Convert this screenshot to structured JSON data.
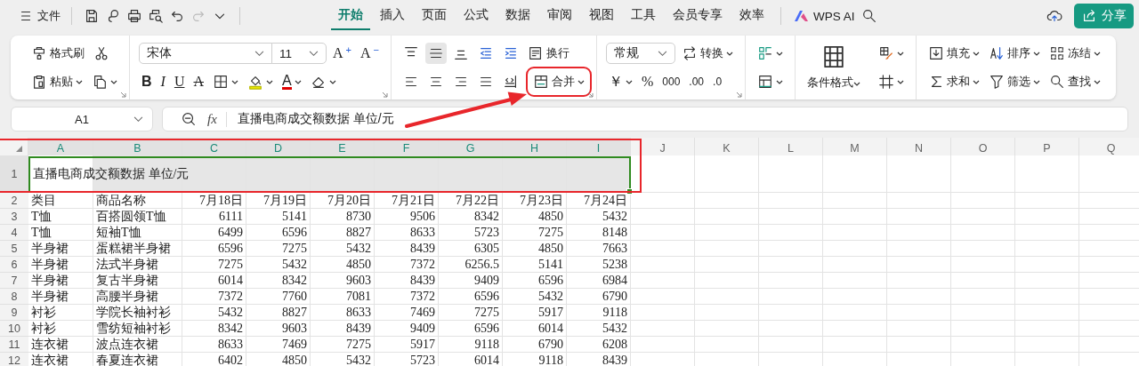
{
  "menu": {
    "label": "文件"
  },
  "quick_access": [
    {
      "kind": "save",
      "disabled": false
    },
    {
      "kind": "curve",
      "disabled": false
    },
    {
      "kind": "print",
      "disabled": false
    },
    {
      "kind": "preview",
      "disabled": false
    },
    {
      "kind": "undo",
      "disabled": false
    },
    {
      "kind": "redo",
      "disabled": true
    },
    {
      "kind": "more",
      "disabled": false
    }
  ],
  "tabs": [
    {
      "label": "开始",
      "selected": true
    },
    {
      "label": "插入",
      "selected": false
    },
    {
      "label": "页面",
      "selected": false
    },
    {
      "label": "公式",
      "selected": false
    },
    {
      "label": "数据",
      "selected": false
    },
    {
      "label": "审阅",
      "selected": false
    },
    {
      "label": "视图",
      "selected": false
    },
    {
      "label": "工具",
      "selected": false
    },
    {
      "label": "会员专享",
      "selected": false
    },
    {
      "label": "效率",
      "selected": false
    }
  ],
  "ai_button": {
    "label": "WPS AI"
  },
  "share_button": {
    "label": "分享"
  },
  "ribbon": [
    {
      "kind": "two-line",
      "launcher": true,
      "top": [
        {
          "kind": "format-painter",
          "label": "格式刷",
          "dropdown": false
        },
        {
          "kind": "scissors",
          "dropdown": false
        }
      ],
      "bottom": [
        {
          "kind": "paste",
          "label": "粘贴",
          "dropdown": true
        },
        {
          "kind": "copy",
          "dropdown": true
        }
      ]
    },
    {
      "kind": "two-line",
      "launcher": true,
      "top": [
        {
          "kind": "font-select",
          "value": "宋体",
          "dropdown": true
        },
        {
          "kind": "size-select",
          "value": "11",
          "dropdown": true
        },
        {
          "kind": "grow",
          "glyph": "A",
          "sup": "+",
          "dropdown": false
        },
        {
          "kind": "shrink",
          "glyph": "A",
          "sup": "−",
          "dropdown": false
        }
      ],
      "bottom": [
        {
          "kind": "bold",
          "glyph": "B",
          "dropdown": false
        },
        {
          "kind": "italic",
          "glyph": "I",
          "dropdown": false
        },
        {
          "kind": "underline",
          "glyph": "U",
          "dropdown": false
        },
        {
          "kind": "strike",
          "glyph": "A",
          "dropdown": false
        },
        {
          "kind": "borders",
          "dropdown": true
        },
        {
          "kind": "fill-color",
          "dropdown": true
        },
        {
          "kind": "font-color",
          "glyph": "A",
          "dropdown": true
        },
        {
          "kind": "eraser",
          "dropdown": true
        }
      ]
    },
    {
      "kind": "two-line",
      "launcher": true,
      "top": [
        {
          "kind": "align-top",
          "selected": false,
          "dropdown": false
        },
        {
          "kind": "align-middle",
          "selected": true,
          "dropdown": false
        },
        {
          "kind": "align-bottom",
          "selected": false,
          "dropdown": false
        },
        {
          "kind": "outdent",
          "selected": false,
          "dropdown": false
        },
        {
          "kind": "indent",
          "selected": false,
          "dropdown": false
        },
        {
          "kind": "wrap",
          "label": "换行",
          "selected": false,
          "dropdown": false
        }
      ],
      "bottom": [
        {
          "kind": "align-left",
          "selected": false,
          "dropdown": false
        },
        {
          "kind": "align-center",
          "selected": false,
          "dropdown": false
        },
        {
          "kind": "align-right",
          "selected": false,
          "dropdown": false
        },
        {
          "kind": "justify",
          "selected": false,
          "dropdown": false
        },
        {
          "kind": "distribute",
          "selected": false,
          "dropdown": false
        },
        {
          "kind": "merge",
          "label": "合并",
          "selected": false,
          "dropdown": true
        }
      ]
    },
    {
      "kind": "two-line",
      "launcher": true,
      "top": [
        {
          "kind": "format-select",
          "value": "常规",
          "dropdown": true
        },
        {
          "kind": "convert",
          "label": "转换",
          "dropdown": true
        }
      ],
      "bottom": [
        {
          "kind": "currency",
          "glyph": "￥",
          "dropdown": true
        },
        {
          "kind": "percent",
          "glyph": "%",
          "dropdown": false
        },
        {
          "kind": "thousands",
          "glyph": "000",
          "dropdown": false
        },
        {
          "kind": "decimal-more",
          "glyph": ".00",
          "dropdown": false
        },
        {
          "kind": "decimal-less",
          "glyph": ".0",
          "dropdown": false
        }
      ]
    },
    {
      "kind": "two-line",
      "launcher": false,
      "top": [
        {
          "kind": "cell-style",
          "dropdown": true
        }
      ],
      "bottom": [
        {
          "kind": "table-style",
          "dropdown": true
        }
      ]
    },
    {
      "kind": "big",
      "launcher": false,
      "big": {
        "kind": "conditional",
        "label": "条件格式",
        "dropdown": true
      },
      "top": [
        {
          "kind": "cell-paint",
          "dropdown": true
        }
      ],
      "bottom": [
        {
          "kind": "row-column",
          "dropdown": true
        }
      ]
    },
    {
      "kind": "two-line",
      "launcher": false,
      "top": [
        {
          "kind": "fill",
          "label": "填充",
          "dropdown": true
        },
        {
          "kind": "sort",
          "label": "排序",
          "dropdown": true
        },
        {
          "kind": "freeze",
          "label": "冻结",
          "dropdown": true
        }
      ],
      "bottom": [
        {
          "kind": "sum",
          "label": "求和",
          "dropdown": true
        },
        {
          "kind": "filter",
          "label": "筛选",
          "dropdown": true
        },
        {
          "kind": "find",
          "label": "查找",
          "dropdown": true
        }
      ]
    }
  ],
  "name_box": {
    "value": "A1"
  },
  "formula_bar": {
    "fx": "fx",
    "value": "直播电商成交额数据  单位/元"
  },
  "columns": [
    {
      "letter": "A",
      "selected": true
    },
    {
      "letter": "B",
      "selected": true
    },
    {
      "letter": "C",
      "selected": true
    },
    {
      "letter": "D",
      "selected": true
    },
    {
      "letter": "E",
      "selected": true
    },
    {
      "letter": "F",
      "selected": true
    },
    {
      "letter": "G",
      "selected": true
    },
    {
      "letter": "H",
      "selected": true
    },
    {
      "letter": "I",
      "selected": true
    },
    {
      "letter": "J",
      "selected": false
    },
    {
      "letter": "K",
      "selected": false
    },
    {
      "letter": "L",
      "selected": false
    },
    {
      "letter": "M",
      "selected": false
    },
    {
      "letter": "N",
      "selected": false
    },
    {
      "letter": "O",
      "selected": false
    },
    {
      "letter": "P",
      "selected": false
    },
    {
      "letter": "Q",
      "selected": false
    }
  ],
  "rows": [
    {
      "number": "1",
      "selected": true,
      "cells": [
        "直播电商成交额数据  单位/元"
      ]
    },
    {
      "number": "2",
      "selected": false,
      "cells": [
        "类目",
        "商品名称",
        "7月18日",
        "7月19日",
        "7月20日",
        "7月21日",
        "7月22日",
        "7月23日",
        "7月24日"
      ]
    },
    {
      "number": "3",
      "selected": false,
      "cells": [
        "T恤",
        "百搭圆领T恤",
        "6111",
        "5141",
        "8730",
        "9506",
        "8342",
        "4850",
        "5432"
      ]
    },
    {
      "number": "4",
      "selected": false,
      "cells": [
        "T恤",
        "短袖T恤",
        "6499",
        "6596",
        "8827",
        "8633",
        "5723",
        "7275",
        "8148"
      ]
    },
    {
      "number": "5",
      "selected": false,
      "cells": [
        "半身裙",
        "蛋糕裙半身裙",
        "6596",
        "7275",
        "5432",
        "8439",
        "6305",
        "4850",
        "7663"
      ]
    },
    {
      "number": "6",
      "selected": false,
      "cells": [
        "半身裙",
        "法式半身裙",
        "7275",
        "5432",
        "4850",
        "7372",
        "6256.5",
        "5141",
        "5238"
      ]
    },
    {
      "number": "7",
      "selected": false,
      "cells": [
        "半身裙",
        "复古半身裙",
        "6014",
        "8342",
        "9603",
        "8439",
        "9409",
        "6596",
        "6984"
      ]
    },
    {
      "number": "8",
      "selected": false,
      "cells": [
        "半身裙",
        "高腰半身裙",
        "7372",
        "7760",
        "7081",
        "7372",
        "6596",
        "5432",
        "6790"
      ]
    },
    {
      "number": "9",
      "selected": false,
      "cells": [
        "衬衫",
        "学院长袖衬衫",
        "5432",
        "8827",
        "8633",
        "7469",
        "7275",
        "5917",
        "9118"
      ]
    },
    {
      "number": "10",
      "selected": false,
      "cells": [
        "衬衫",
        "雪纺短袖衬衫",
        "8342",
        "9603",
        "8439",
        "9409",
        "6596",
        "6014",
        "5432"
      ]
    },
    {
      "number": "11",
      "selected": false,
      "cells": [
        "连衣裙",
        "波点连衣裙",
        "8633",
        "7469",
        "7275",
        "5917",
        "9118",
        "6790",
        "6208"
      ]
    },
    {
      "number": "12",
      "selected": false,
      "cells": [
        "连衣裙",
        "春夏连衣裙",
        "6402",
        "4850",
        "5432",
        "5723",
        "6014",
        "9118",
        "8439"
      ]
    }
  ],
  "annotations": [
    {
      "kind": "merge-box"
    },
    {
      "kind": "arrow"
    },
    {
      "kind": "title-row-box"
    }
  ]
}
